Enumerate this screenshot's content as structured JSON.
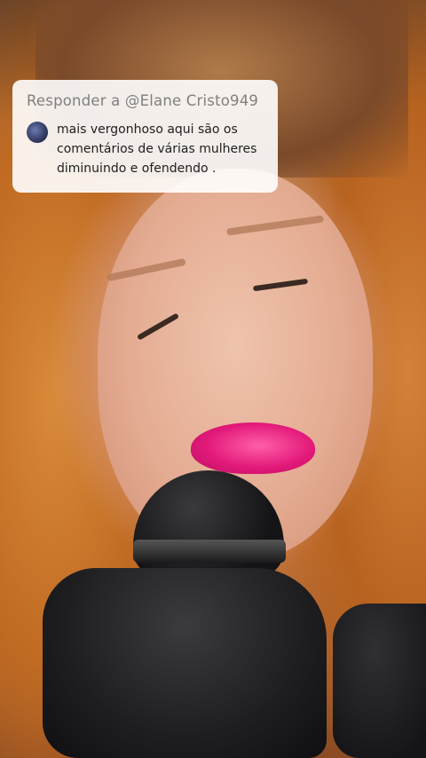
{
  "reply": {
    "header": "Responder a @Elane Cristo949",
    "comment": "mais vergonhoso aqui são os\ncomentários de várias mulheres\ndiminuindo e ofendendo ."
  }
}
